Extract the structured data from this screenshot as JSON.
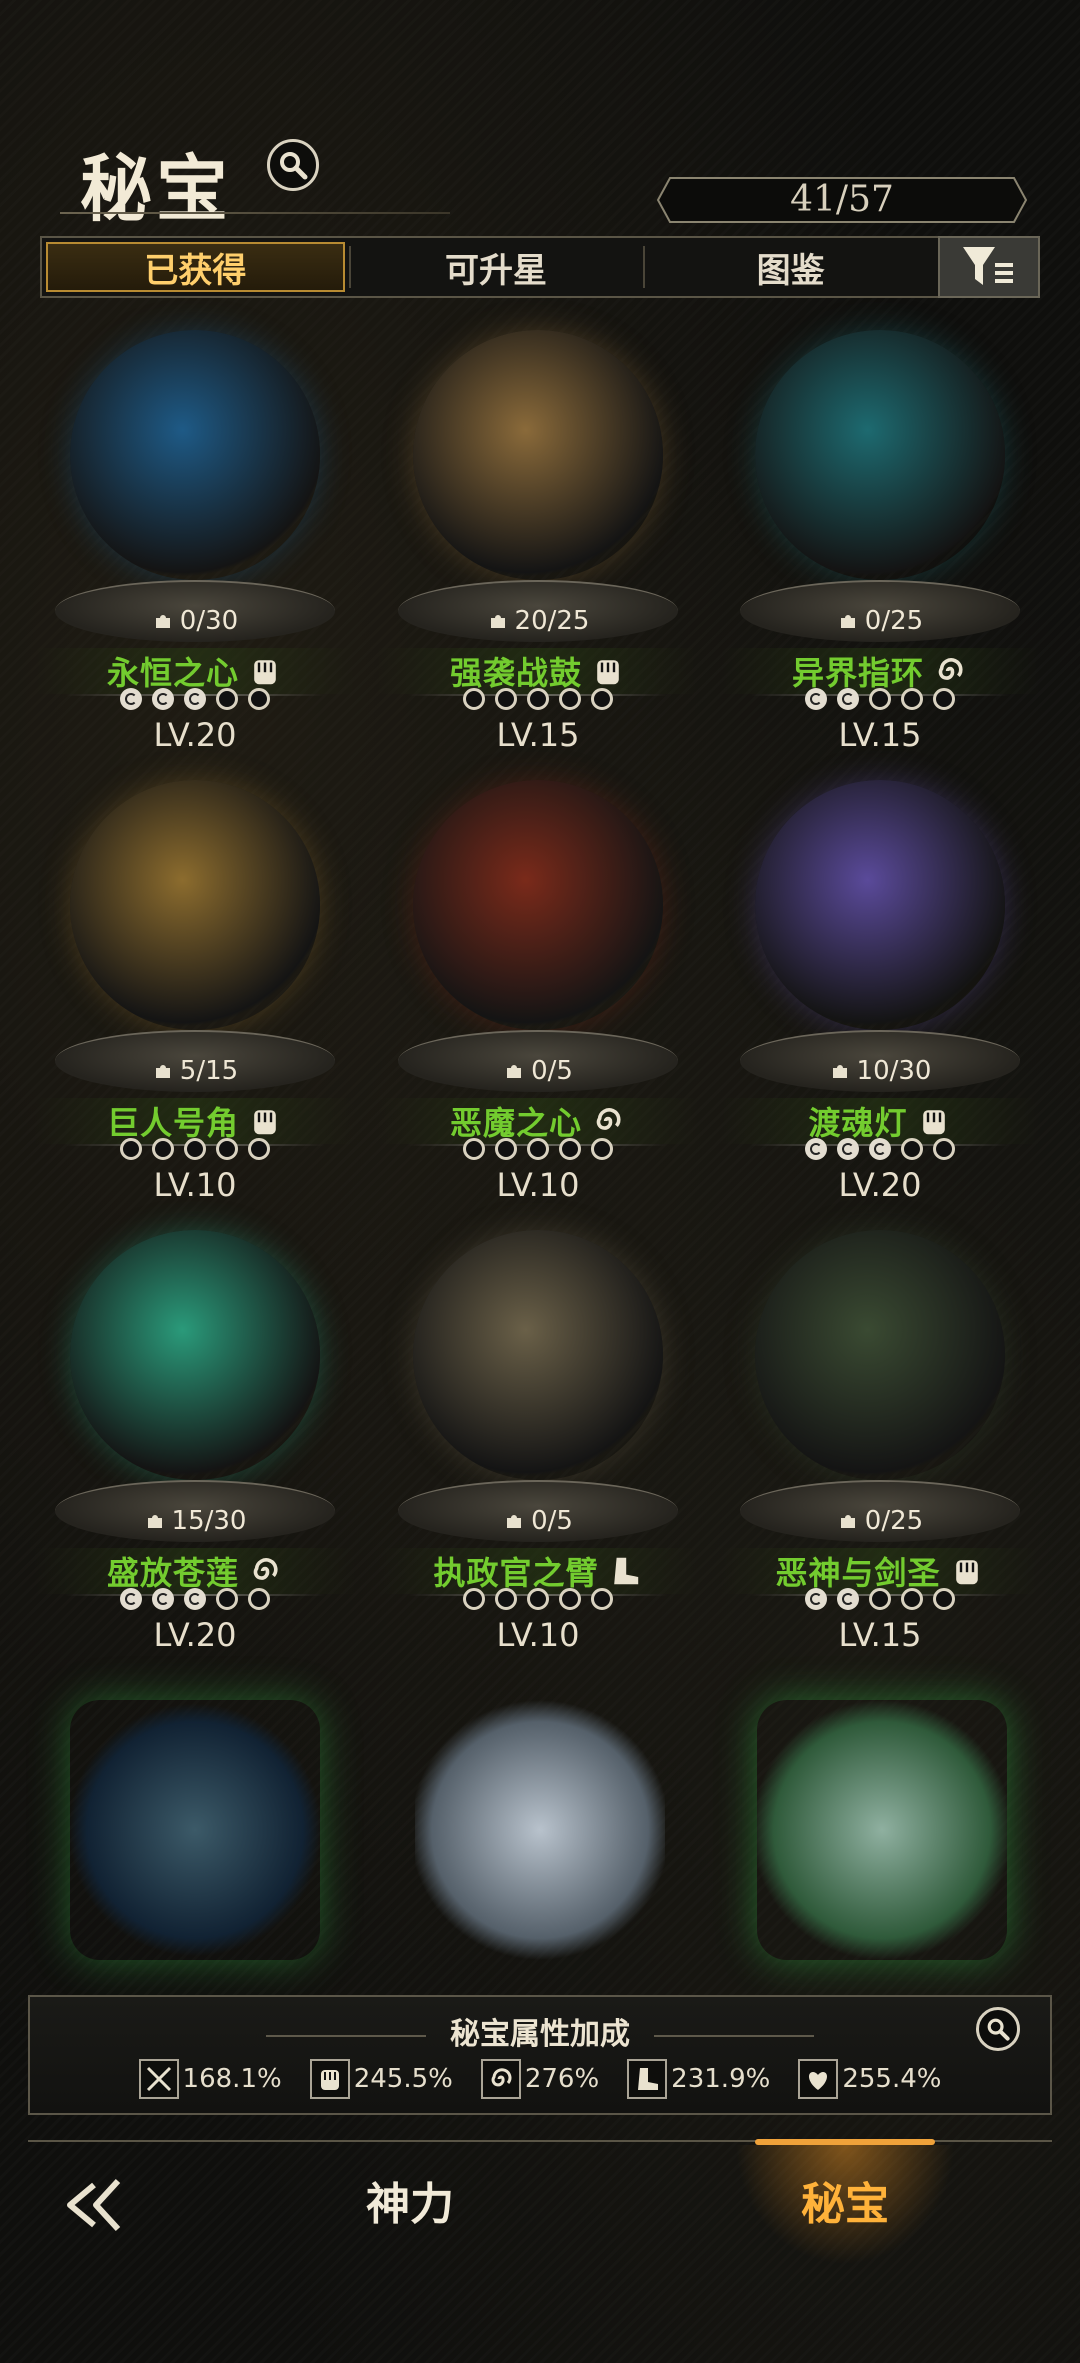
{
  "header": {
    "title": "秘宝",
    "counter": "41/57"
  },
  "tabs": [
    {
      "label": "已获得",
      "active": true
    },
    {
      "label": "可升星",
      "active": false
    },
    {
      "label": "图鉴",
      "active": false
    }
  ],
  "items": [
    {
      "name": "永恒之心",
      "fragments": "0/30",
      "level": "LV.20",
      "stars_filled": 3,
      "stars_total": 5,
      "type_icon": "fist-icon",
      "art_color": "#1e5a86"
    },
    {
      "name": "强袭战鼓",
      "fragments": "20/25",
      "level": "LV.15",
      "stars_filled": 0,
      "stars_total": 5,
      "type_icon": "fist-icon",
      "art_color": "#8a6a3a"
    },
    {
      "name": "异界指环",
      "fragments": "0/25",
      "level": "LV.15",
      "stars_filled": 2,
      "stars_total": 5,
      "type_icon": "swirl-icon",
      "art_color": "#1d6a70"
    },
    {
      "name": "巨人号角",
      "fragments": "5/15",
      "level": "LV.10",
      "stars_filled": 0,
      "stars_total": 5,
      "type_icon": "fist-icon",
      "art_color": "#8c6c2e"
    },
    {
      "name": "恶魔之心",
      "fragments": "0/5",
      "level": "LV.10",
      "stars_filled": 0,
      "stars_total": 5,
      "type_icon": "swirl-icon",
      "art_color": "#7a2a1a"
    },
    {
      "name": "渡魂灯",
      "fragments": "10/30",
      "level": "LV.20",
      "stars_filled": 3,
      "stars_total": 5,
      "type_icon": "fist-icon",
      "art_color": "#5a4a9a"
    },
    {
      "name": "盛放苍莲",
      "fragments": "15/30",
      "level": "LV.20",
      "stars_filled": 3,
      "stars_total": 5,
      "type_icon": "swirl-icon",
      "art_color": "#2a9a7a"
    },
    {
      "name": "执政官之臂",
      "fragments": "0/5",
      "level": "LV.10",
      "stars_filled": 0,
      "stars_total": 5,
      "type_icon": "boot-icon",
      "art_color": "#6a6048"
    },
    {
      "name": "恶神与剑圣",
      "fragments": "0/25",
      "level": "LV.15",
      "stars_filled": 2,
      "stars_total": 5,
      "type_icon": "fist-icon",
      "art_color": "#3a4a32"
    }
  ],
  "bonus": {
    "title": "秘宝属性加成",
    "stats": [
      {
        "icon": "sword-icon",
        "value": "168.1%"
      },
      {
        "icon": "fist-icon",
        "value": "245.5%"
      },
      {
        "icon": "swirl-icon",
        "value": "276%"
      },
      {
        "icon": "boot-icon",
        "value": "231.9%"
      },
      {
        "icon": "hand-heart-icon",
        "value": "255.4%"
      }
    ]
  },
  "nav": {
    "power": "神力",
    "treasure": "秘宝"
  },
  "colors": {
    "accent": "#ffb23a",
    "name_green": "#73cc2f",
    "tab_active_border": "#b88b32"
  }
}
